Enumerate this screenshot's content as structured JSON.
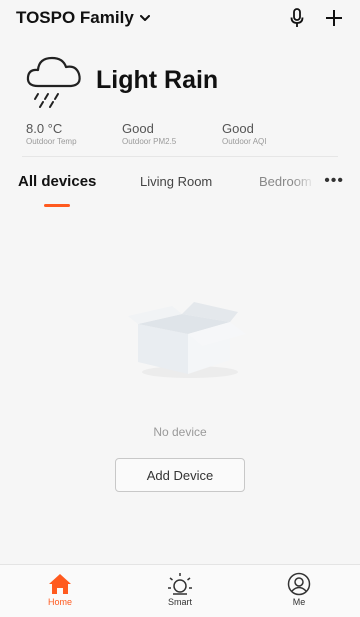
{
  "header": {
    "family_name": "TOSPO Family"
  },
  "weather": {
    "condition": "Light Rain"
  },
  "stats": [
    {
      "value": "8.0 °C",
      "label": "Outdoor Temp"
    },
    {
      "value": "Good",
      "label": "Outdoor PM2.5"
    },
    {
      "value": "Good",
      "label": "Outdoor AQI"
    }
  ],
  "tabs": [
    {
      "label": "All devices",
      "active": true
    },
    {
      "label": "Living Room",
      "active": false
    },
    {
      "label": "Bedroom",
      "active": false
    }
  ],
  "more_label": "•••",
  "empty": {
    "message": "No device",
    "button": "Add Device"
  },
  "bottom_nav": [
    {
      "label": "Home",
      "icon": "home-icon",
      "active": true
    },
    {
      "label": "Smart",
      "icon": "sun-icon",
      "active": false
    },
    {
      "label": "Me",
      "icon": "user-icon",
      "active": false
    }
  ],
  "colors": {
    "accent": "#ff5a1f",
    "background": "#f6f6f6"
  }
}
